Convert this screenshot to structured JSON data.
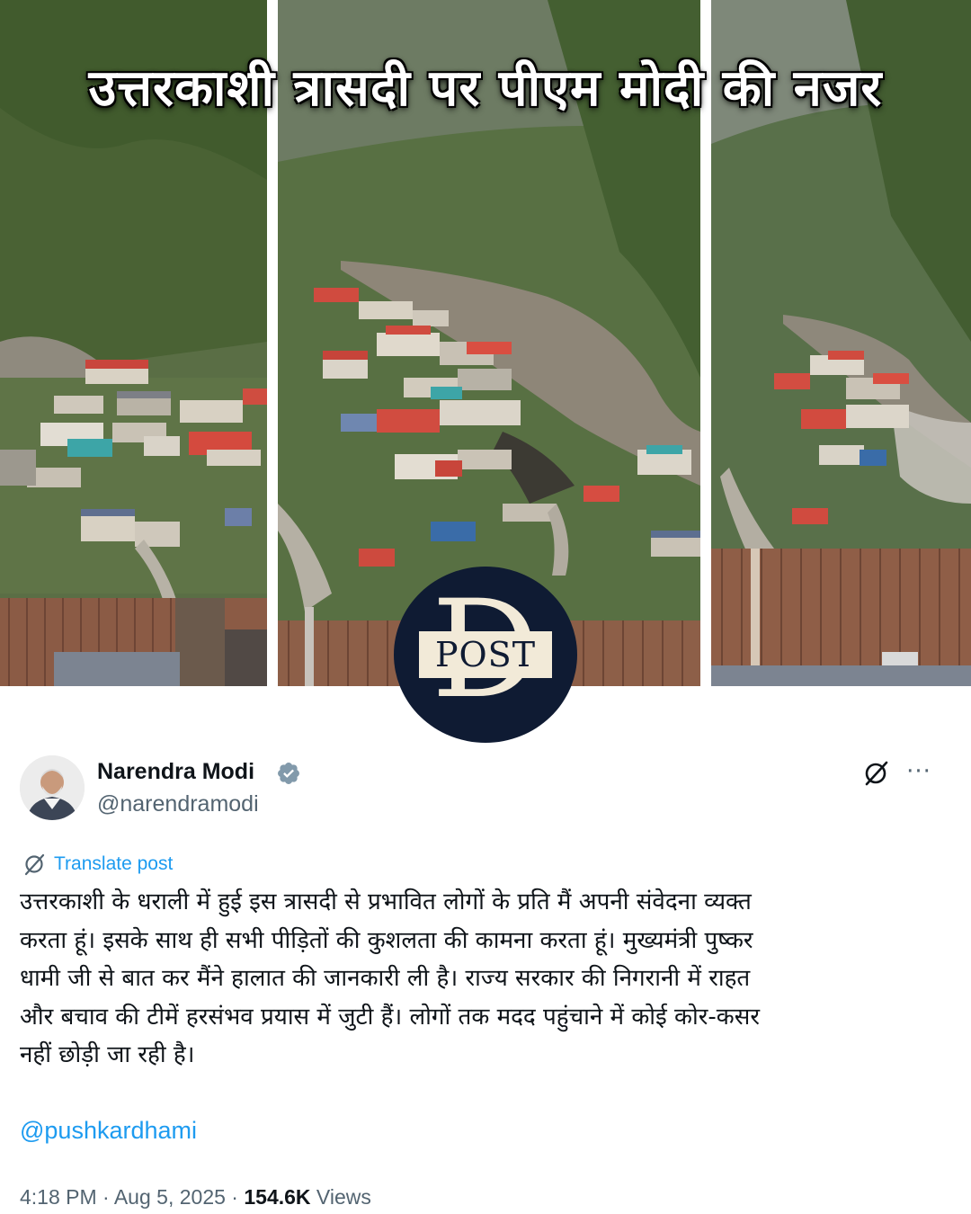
{
  "collage": {
    "headline": "उत्तरकाशी त्रासदी पर पीएम मोदी की नजर",
    "photos": [
      "landslide-photo-1",
      "landslide-photo-2",
      "landslide-photo-3"
    ]
  },
  "logo": {
    "letter": "D",
    "word": "POST",
    "background": "#0f1b33",
    "foreground": "#f2ead8"
  },
  "tweet": {
    "author_name": "Narendra Modi",
    "handle": "@narendramodi",
    "verified_icon": "verified-badge-icon",
    "grok_icon": "grok-icon",
    "more_icon": "more-horizontal-icon",
    "translate_label": "Translate post",
    "body_lines": [
      "उत्तरकाशी के धराली में हुई इस त्रासदी से प्रभावित लोगों के प्रति मैं अपनी संवेदना व्यक्त",
      "करता हूं। इसके साथ ही सभी पीड़ितों की कुशलता की कामना करता हूं। मुख्यमंत्री पुष्कर",
      "धामी जी से बात कर मैंने हालात की जानकारी ली है। राज्य सरकार की निगरानी में राहत",
      "और बचाव की टीमें हरसंभव प्रयास में जुटी हैं। लोगों तक मदद पहुंचाने में कोई कोर-कसर",
      "नहीं छोड़ी जा रही है।"
    ],
    "mention": "@pushkardhami",
    "time": "4:18 PM",
    "separator": "·",
    "date": "Aug 5, 2025",
    "views_count": "154.6K",
    "views_label": "Views",
    "colors": {
      "link": "#1d9bf0",
      "text": "#0f1419",
      "muted": "#536471"
    }
  }
}
